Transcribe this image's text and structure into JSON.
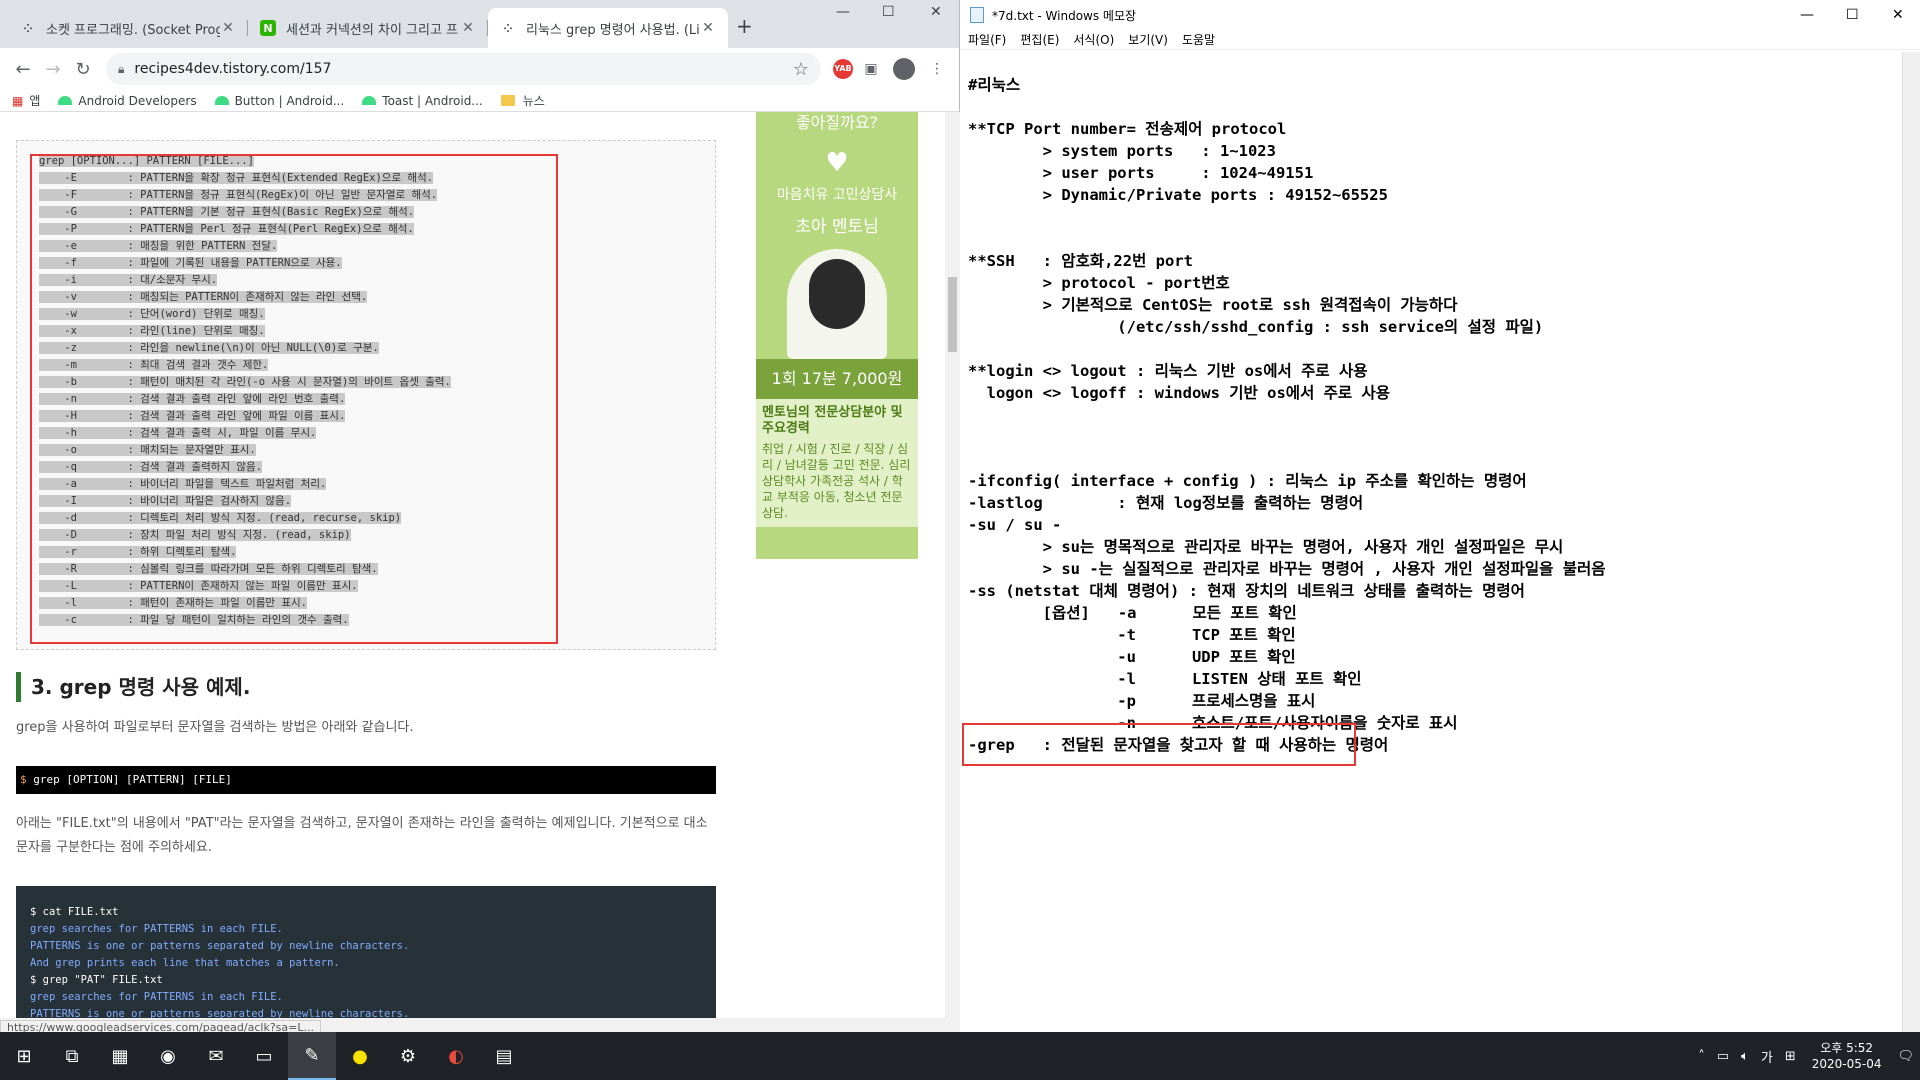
{
  "chrome": {
    "tabs": [
      {
        "title": "소켓 프로그래밍. (Socket Progra",
        "icon": "tistory-icon"
      },
      {
        "title": "세션과 커넥션의 차이 그리고 프",
        "icon": "naver-icon"
      },
      {
        "title": "리눅스 grep 명령어 사용법. (Lin",
        "icon": "tistory-icon"
      }
    ],
    "url": "recipes4dev.tistory.com/157",
    "bookmarks": [
      "앱",
      "Android Developers",
      "Button | Android...",
      "Toast | Android...",
      "뉴스"
    ],
    "status_url": "https://www.googleadservices.com/pagead/aclk?sa=L..."
  },
  "article": {
    "code_lines": [
      "grep [OPTION...] PATTERN [FILE...]",
      "    -E        : PATTERN을 확장 정규 표현식(Extended RegEx)으로 해석.",
      "    -F        : PATTERN을 정규 표현식(RegEx)이 아닌 일반 문자열로 해석.",
      "    -G        : PATTERN을 기본 정규 표현식(Basic RegEx)으로 해석.",
      "    -P        : PATTERN을 Perl 정규 표현식(Perl RegEx)으로 해석.",
      "    -e        : 매칭을 위한 PATTERN 전달.",
      "    -f        : 파일에 기록된 내용을 PATTERN으로 사용.",
      "    -i        : 대/소문자 무시.",
      "    -v        : 매칭되는 PATTERN이 존재하지 않는 라인 선택.",
      "    -w        : 단어(word) 단위로 매칭.",
      "    -x        : 라인(line) 단위로 매칭.",
      "    -z        : 라인을 newline(\\n)이 아닌 NULL(\\0)로 구분.",
      "    -m        : 최대 검색 결과 갯수 제한.",
      "    -b        : 패턴이 매치된 각 라인(-o 사용 시 문자열)의 바이트 옵셋 출력.",
      "    -n        : 검색 결과 출력 라인 앞에 라인 번호 출력.",
      "    -H        : 검색 결과 출력 라인 앞에 파일 이름 표시.",
      "    -h        : 검색 결과 출력 시, 파일 이름 무시.",
      "    -o        : 매치되는 문자열만 표시.",
      "    -q        : 검색 결과 출력하지 않음.",
      "    -a        : 바이너리 파일을 텍스트 파일처럼 처리.",
      "    -I        : 바이너리 파일은 검사하지 않음.",
      "    -d        : 디렉토리 처리 방식 지정. (read, recurse, skip)",
      "    -D        : 장치 파일 처리 방식 지정. (read, skip)",
      "    -r        : 하위 디렉토리 탐색.",
      "    -R        : 심볼릭 링크를 따라가며 모든 하위 디렉토리 탐색.",
      "    -L        : PATTERN이 존재하지 않는 파일 이름만 표시.",
      "    -l        : 패턴이 존재하는 파일 이름만 표시.",
      "    -c        : 파일 당 패턴이 일치하는 라인의 갯수 출력."
    ],
    "heading": "3. grep 명령 사용 예제.",
    "para1": "grep을 사용하여 파일로부터 문자열을 검색하는 방법은 아래와 같습니다.",
    "cmd_prompt": "$",
    "cmd_text": "grep [OPTION] [PATTERN] [FILE]",
    "para2": "아래는 \"FILE.txt\"의 내용에서 \"PAT\"라는 문자열을 검색하고, 문자열이 존재하는 라인을 출력하는 예제입니다. 기본적으로 대소문자를 구분한다는 점에 주의하세요.",
    "term_lines": [
      {
        "kind": "cmd",
        "text": "$ cat FILE.txt"
      },
      {
        "kind": "out",
        "text": "grep searches for PATTERNS in each FILE."
      },
      {
        "kind": "out",
        "text": "PATTERNS is one or patterns separated by newline characters."
      },
      {
        "kind": "out",
        "text": "And grep prints each line that matches a pattern."
      },
      {
        "kind": "cmd",
        "text": "$ grep \"PAT\" FILE.txt"
      },
      {
        "kind": "out",
        "text": "grep searches for PATTERNS in each FILE."
      },
      {
        "kind": "out",
        "text": "PATTERNS is one or patterns separated by newline characters."
      }
    ]
  },
  "ad": {
    "top": "좋아질까요?",
    "heart": "♥",
    "line1": "마음치유 고민상담사",
    "line2": "초아 멘토님",
    "price": "1회 17분 7,000원",
    "sub_title": "멘토님의 전문상담분야 및 주요경력",
    "sub_text": "취업 / 시험 / 진로 / 직장 / 심리 / 남녀갈등 고민 전문. 심리상담학사 가족전공 석사 / 학교 부적응 아동, 청소년 전문상담."
  },
  "notepad": {
    "title": "*7d.txt - Windows 메모장",
    "menu": [
      "파일(F)",
      "편집(E)",
      "서식(O)",
      "보기(V)",
      "도움말"
    ],
    "lines": [
      "#리눅스",
      "",
      "**TCP Port number= 전송제어 protocol",
      "        > system ports   : 1~1023",
      "        > user ports     : 1024~49151",
      "        > Dynamic/Private ports : 49152~65525",
      "",
      "",
      "**SSH   : 암호화,22번 port",
      "        > protocol - port번호",
      "        > 기본적으로 CentOS는 root로 ssh 원격접속이 가능하다",
      "                (/etc/ssh/sshd_config : ssh service의 설정 파일)",
      "",
      "**login <> logout : 리눅스 기반 os에서 주로 사용",
      "  logon <> logoff : windows 기반 os에서 주로 사용",
      "",
      "",
      "",
      "-ifconfig( interface + config ) : 리눅스 ip 주소를 확인하는 명령어",
      "-lastlog        : 현재 log정보를 출력하는 명령어",
      "-su / su -",
      "        > su는 명목적으로 관리자로 바꾸는 명령어, 사용자 개인 설정파일은 무시",
      "        > su -는 실질적으로 관리자로 바꾸는 명령어 , 사용자 개인 설정파일을 불러옴",
      "-ss (netstat 대체 명령어) : 현재 장치의 네트워크 상태를 출력하는 명령어",
      "        [옵션]   -a      모든 포트 확인",
      "                -t      TCP 포트 확인",
      "                -u      UDP 포트 확인",
      "                -l      LISTEN 상태 포트 확인",
      "                -p      프로세스명을 표시",
      "                -n      호스트/포트/사용자이름을 숫자로 표시",
      "-grep   : 전달된 문자열을 찾고자 할 때 사용하는 명령어"
    ]
  },
  "taskbar": {
    "apps": [
      "task-view",
      "calculator",
      "chrome",
      "outlook",
      "explorer",
      "notepad",
      "kakaotalk",
      "app-7",
      "app-8",
      "app-9"
    ],
    "ime": "가",
    "time": "오후 5:52",
    "date": "2020-05-04"
  }
}
